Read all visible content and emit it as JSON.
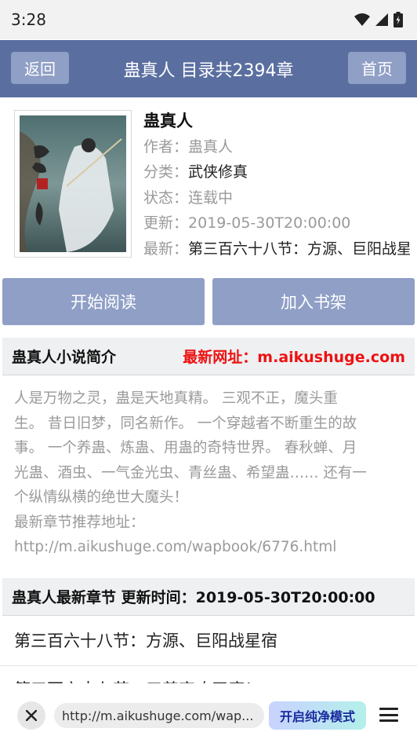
{
  "status": {
    "time": "3:28"
  },
  "header": {
    "back_label": "返回",
    "title": "蛊真人 目录共2394章",
    "home_label": "首页"
  },
  "book": {
    "title": "蛊真人",
    "author_label": "作者：",
    "author": "蛊真人",
    "category_label": "分类：",
    "category": "武侠修真",
    "status_label": "状态：",
    "status": "连载中",
    "updated_label": "更新：",
    "updated": "2019-05-30T20:00:00",
    "latest_label": "最新：",
    "latest": "第三百六十八节：方源、巨阳战星宿"
  },
  "actions": {
    "start_reading": "开始阅读",
    "add_shelf": "加入书架"
  },
  "intro": {
    "heading": "蛊真人小说简介",
    "latest_url": "最新网址：m.aikushuge.com",
    "lines": [
      "人是万物之灵，蛊是天地真精。 三观不正，魔头重",
      "生。 昔日旧梦，同名新作。 一个穿越者不断重生的故",
      "事。 一个养蛊、炼蛊、用蛊的奇特世界。 春秋蝉、月",
      "光蛊、酒虫、一气金光虫、青丝蛊、希望蛊…… 还有一",
      "个纵情纵横的绝世大魔头！",
      "最新章节推荐地址：",
      "http://m.aikushuge.com/wapbook/6776.html"
    ]
  },
  "chapters": {
    "heading": "蛊真人最新章节 更新时间：2019-05-30T20:00:00",
    "items": [
      "第三百六十八节：方源、巨阳战星宿",
      "第三百六十七节：三尊齐攻天庭！"
    ]
  },
  "browser": {
    "url": "http://m.aikushuge.com/wap...",
    "clean_mode": "开启纯净模式"
  },
  "colors": {
    "header_bg": "#5a6ea0",
    "button_bg": "#8f9fc6",
    "accent_red": "#ee1111"
  }
}
